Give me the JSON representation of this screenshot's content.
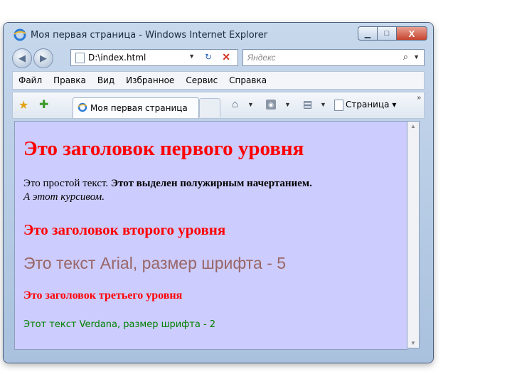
{
  "window": {
    "title": "Моя первая страница - Windows Internet Explorer",
    "controls": {
      "minimize": "▁",
      "maximize": "□",
      "close": "X"
    }
  },
  "navigation": {
    "back_glyph": "◀",
    "forward_glyph": "▶",
    "address_value": "D:\\index.html",
    "refresh_glyph": "↻",
    "stop_glyph": "✕",
    "search_placeholder": "Яндекс",
    "search_glyph": "⌕"
  },
  "menu": {
    "items": [
      "Файл",
      "Правка",
      "Вид",
      "Избранное",
      "Сервис",
      "Справка"
    ]
  },
  "command_bar": {
    "tab_title": "Моя первая страница",
    "page_menu": "Страница",
    "icons": [
      "favorites-star-icon",
      "add-favorites-icon",
      "home-icon",
      "rss-feed-icon",
      "print-icon",
      "page-icon"
    ],
    "more_glyph": "»"
  },
  "page": {
    "background": "#ccccff",
    "heading1": "Это заголовок первого уровня",
    "paragraph_plain": "Это простой текст. ",
    "paragraph_bold": "Этот выделен полужирным начертанием.",
    "paragraph_italic": "А этот курсивом.",
    "heading2": "Это заголовок второго уровня",
    "arial_text": "Это текст Arial, размер шрифта - 5",
    "heading3": "Это заголовок третьего уровня",
    "verdana_text": "Этот текст Verdana, размер шрифта - 2",
    "colors": {
      "heading": "#ff0000",
      "arial_text": "#996666",
      "verdana_text": "#008000"
    }
  }
}
